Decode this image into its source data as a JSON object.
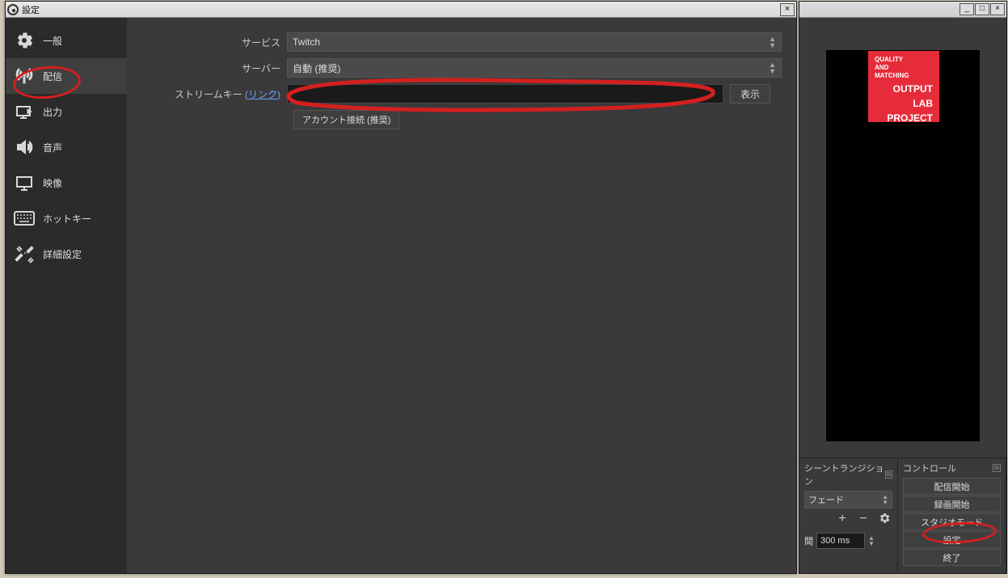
{
  "settings": {
    "window_title": "設定",
    "sidebar": [
      {
        "label": "一般"
      },
      {
        "label": "配信"
      },
      {
        "label": "出力"
      },
      {
        "label": "音声"
      },
      {
        "label": "映像"
      },
      {
        "label": "ホットキー"
      },
      {
        "label": "詳細設定"
      }
    ],
    "form": {
      "service_label": "サービス",
      "service_value": "Twitch",
      "server_label": "サーバー",
      "server_value": "自動 (推奨)",
      "streamkey_label": "ストリームキー",
      "streamkey_link": "(リンク)",
      "streamkey_value": "",
      "show_button": "表示",
      "connect_account_button": "アカウント接続 (推奨)"
    }
  },
  "main": {
    "logo": {
      "line1": "QUALITY",
      "line2": "AND",
      "line3": "MATCHING",
      "big1": "OUTPUT",
      "big2": "LAB",
      "big3": "PROJECT"
    },
    "transitions": {
      "header": "シーントランジション",
      "type": "フェード",
      "duration_label": "間",
      "duration_value": "300 ms"
    },
    "controls": {
      "header": "コントロール",
      "buttons": [
        "配信開始",
        "録画開始",
        "スタジオモード",
        "設定",
        "終了"
      ]
    }
  }
}
